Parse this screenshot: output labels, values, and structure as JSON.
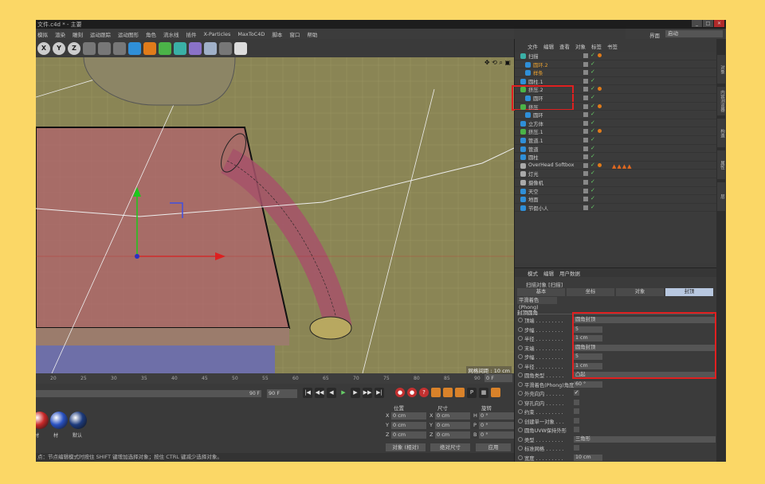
{
  "app": {
    "title": "文件.c4d * - 主要",
    "layout_label": "界面",
    "layout_value": "启动"
  },
  "menu": [
    "模拟",
    "渲染",
    "雕刻",
    "运动跟踪",
    "运动图形",
    "角色",
    "流水线",
    "插件",
    "X-Particles",
    "MaxToC4D",
    "脚本",
    "窗口",
    "帮助"
  ],
  "toolbar": {
    "axes": [
      "X",
      "Y",
      "Z"
    ],
    "tools": [
      "clapper",
      "render-view",
      "render-settings",
      "cube",
      "pen",
      "subdivision",
      "array",
      "deformer",
      "floor",
      "camera",
      "light"
    ]
  },
  "viewport": {
    "grid_spacing_label": "网格间距 : 10 cm",
    "accent_bg": "#8a8555"
  },
  "timeline": {
    "ticks": [
      "20",
      "25",
      "30",
      "35",
      "40",
      "45",
      "50",
      "55",
      "60",
      "65",
      "70",
      "75",
      "80",
      "85",
      "90"
    ],
    "frame_field": "0 F",
    "scrub_end": "90 F",
    "end_field": "90 F"
  },
  "materials": [
    {
      "label": "材",
      "color": "#c82828"
    },
    {
      "label": "材",
      "color": "#2850c0"
    },
    {
      "label": "默认",
      "color": "#1c3a7c"
    }
  ],
  "coords": {
    "headers": [
      "位置",
      "尺寸",
      "旋转"
    ],
    "pos": [
      {
        "ax": "X",
        "val": "0 cm"
      },
      {
        "ax": "Y",
        "val": "0 cm"
      },
      {
        "ax": "Z",
        "val": "0 cm"
      }
    ],
    "size": [
      {
        "ax": "X",
        "val": "0 cm"
      },
      {
        "ax": "Y",
        "val": "0 cm"
      },
      {
        "ax": "Z",
        "val": "0 cm"
      }
    ],
    "rot": [
      {
        "ax": "H",
        "val": "0 °"
      },
      {
        "ax": "P",
        "val": "0 °"
      },
      {
        "ax": "B",
        "val": "0 °"
      }
    ],
    "mode": "对象 (相对)",
    "size_mode": "绝对尺寸",
    "apply": "应用"
  },
  "status": "点：节点编辑模式时按住 SHIFT 键增加选择对象；按住 CTRL 键减少选择对象。",
  "object_manager": {
    "menu": [
      "文件",
      "编辑",
      "查看",
      "对象",
      "标签",
      "书签"
    ],
    "rows": [
      {
        "name": "扫描",
        "indent": 0,
        "color": "#3ab0a6",
        "selected": true
      },
      {
        "name": "圆环.2",
        "indent": 1,
        "color": "#2f8fd8",
        "selected": true
      },
      {
        "name": "样条",
        "indent": 1,
        "color": "#2f8fd8",
        "selected": true
      },
      {
        "name": "圆柱.1",
        "indent": 0,
        "color": "#2f8fd8",
        "selected": false
      },
      {
        "name": "挤压.2",
        "indent": 0,
        "color": "#4bb348",
        "selected": false
      },
      {
        "name": "圆环",
        "indent": 1,
        "color": "#2f8fd8",
        "selected": false
      },
      {
        "name": "挤压",
        "indent": 0,
        "color": "#4bb348",
        "selected": false
      },
      {
        "name": "圆环",
        "indent": 1,
        "color": "#2f8fd8",
        "selected": false
      },
      {
        "name": "立方体",
        "indent": 0,
        "color": "#2f8fd8",
        "selected": false
      },
      {
        "name": "挤压.1",
        "indent": 0,
        "color": "#4bb348",
        "selected": false
      },
      {
        "name": "管道.1",
        "indent": 0,
        "color": "#2f8fd8",
        "selected": false
      },
      {
        "name": "管道",
        "indent": 0,
        "color": "#2f8fd8",
        "selected": false
      },
      {
        "name": "圆柱",
        "indent": 0,
        "color": "#2f8fd8",
        "selected": false
      },
      {
        "name": "OverHead Softbox",
        "indent": 0,
        "color": "#aaaaaa",
        "selected": false
      },
      {
        "name": "灯光",
        "indent": 0,
        "color": "#aaaaaa",
        "selected": false
      },
      {
        "name": "摄像机",
        "indent": 0,
        "color": "#aaaaaa",
        "selected": false
      },
      {
        "name": "天空",
        "indent": 0,
        "color": "#2f8fd8",
        "selected": false
      },
      {
        "name": "地面",
        "indent": 0,
        "color": "#2f8fd8",
        "selected": false
      },
      {
        "name": "节假小人",
        "indent": 0,
        "color": "#2f8fd8",
        "selected": false
      }
    ]
  },
  "attributes": {
    "menu": [
      "模式",
      "编辑",
      "用户数据"
    ],
    "title": "扫描对象 [扫描]",
    "tabs": [
      "基本",
      "坐标",
      "对象",
      "封顶"
    ],
    "active_tab": "封顶",
    "phong_tab": "平滑着色(Phong)",
    "section": "封顶圆角",
    "props": [
      {
        "label": "顶端 . . . . . . . . .",
        "type": "dropdown",
        "value": "圆角封顶"
      },
      {
        "label": "步幅 . . . . . . . . .",
        "type": "number",
        "value": "5"
      },
      {
        "label": "半径 . . . . . . . . .",
        "type": "number",
        "value": "1 cm"
      },
      {
        "label": "末端 . . . . . . . . .",
        "type": "dropdown",
        "value": "圆角封顶"
      },
      {
        "label": "步幅 . . . . . . . . .",
        "type": "number",
        "value": "5"
      },
      {
        "label": "半径 . . . . . . . . .",
        "type": "number",
        "value": "1 cm"
      },
      {
        "label": "圆角类型 . . . . . .",
        "type": "dropdown",
        "value": "凸起"
      },
      {
        "label": "平滑着色(Phong)角度",
        "type": "number",
        "value": "60 °"
      },
      {
        "label": "外壳向内 . . . . . .",
        "type": "check",
        "value": "✓"
      },
      {
        "label": "穿孔向内 . . . . . .",
        "type": "check",
        "value": ""
      },
      {
        "label": "约束 . . . . . . . . .",
        "type": "check",
        "value": ""
      },
      {
        "label": "创建单一对象 . . .",
        "type": "check",
        "value": ""
      },
      {
        "label": "圆角UVW保持外形",
        "type": "check",
        "value": ""
      },
      {
        "label": "类型 . . . . . . . . .",
        "type": "dropdown",
        "value": "三角形"
      },
      {
        "label": "标准网格 . . . . . .",
        "type": "check",
        "value": ""
      },
      {
        "label": "宽度 . . . . . . . . .",
        "type": "number",
        "value": "10 cm"
      }
    ]
  },
  "sidetabs": [
    "对象",
    "内容浏览器",
    "构造",
    "属性",
    "层"
  ]
}
